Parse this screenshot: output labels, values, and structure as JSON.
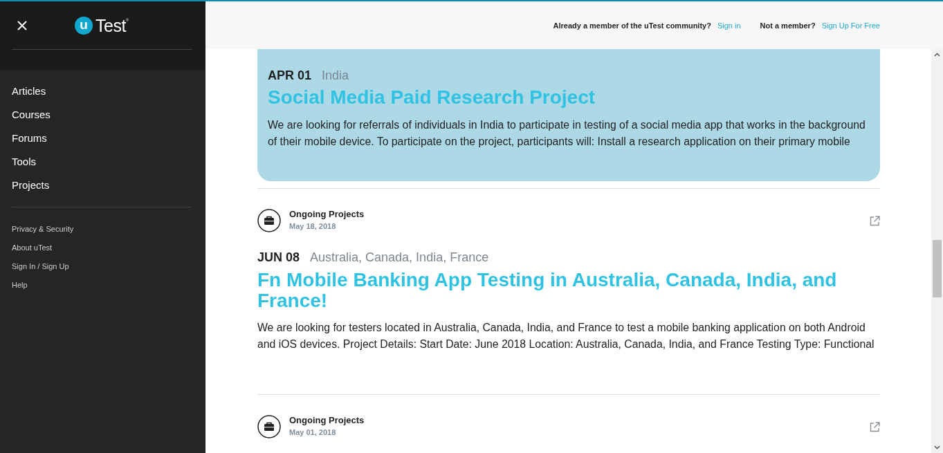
{
  "sidebar": {
    "logo": {
      "mark": "u",
      "name": "Test",
      "symbol": "®"
    },
    "nav_items": [
      "Articles",
      "Courses",
      "Forums",
      "Tools",
      "Projects"
    ],
    "footer_links": [
      "Privacy & Security",
      "About uTest",
      "Sign In / Sign Up",
      "Help"
    ]
  },
  "header": {
    "member_prompt": "Already a member of the uTest community?",
    "sign_in_link": "Sign in",
    "non_member_prompt": "Not a member?",
    "sign_up_link": "Sign Up For Free"
  },
  "feed": [
    {
      "kind": "featured",
      "date": "APR 01",
      "location": "India",
      "title": "Social Media Paid Research Project",
      "description": "We are looking for referrals of individuals in India to participate in testing of a social media app that works in the background of their mobile device. To participate on the project, participants will: Install a research application on their primary mobile"
    },
    {
      "kind": "post",
      "category": "Ongoing Projects",
      "posted": "May 18, 2018",
      "date": "JUN 08",
      "location": "Australia, Canada, India, France",
      "title": "Fn Mobile Banking App Testing in Australia, Canada, India, and France!",
      "description": "We are looking for testers located in Australia, Canada, India, and France to test a mobile banking application on both Android and iOS devices. Project Details: Start Date: June 2018 Location: Australia, Canada, India, and France Testing Type: Functional"
    },
    {
      "kind": "post",
      "category": "Ongoing Projects",
      "posted": "May 01, 2018"
    }
  ]
}
